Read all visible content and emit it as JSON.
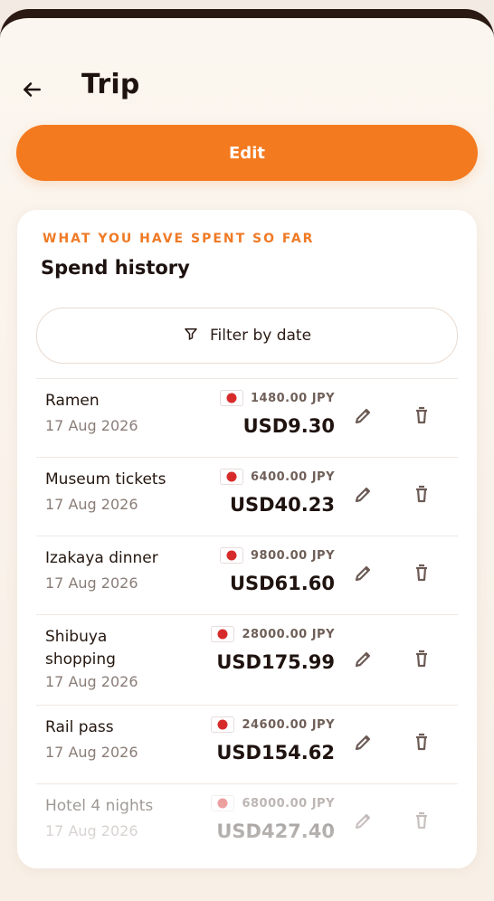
{
  "header": {
    "title": "Trip"
  },
  "actions": {
    "edit_label": "Edit"
  },
  "card": {
    "eyebrow": "WHAT YOU HAVE SPENT SO FAR",
    "title": "Spend history",
    "filter_label": "Filter by date"
  },
  "expenses": [
    {
      "name": "Ramen",
      "date": "17 Aug 2026",
      "local": "1480.00 JPY",
      "usd": "USD9.30"
    },
    {
      "name": "Museum tickets",
      "date": "17 Aug 2026",
      "local": "6400.00 JPY",
      "usd": "USD40.23"
    },
    {
      "name": "Izakaya dinner",
      "date": "17 Aug 2026",
      "local": "9800.00 JPY",
      "usd": "USD61.60"
    },
    {
      "name": "Shibuya shopping",
      "date": "17 Aug 2026",
      "local": "28000.00 JPY",
      "usd": "USD175.99"
    },
    {
      "name": "Rail pass",
      "date": "17 Aug 2026",
      "local": "24600.00 JPY",
      "usd": "USD154.62"
    },
    {
      "name": "Hotel 4 nights",
      "date": "17 Aug 2026",
      "local": "68000.00 JPY",
      "usd": "USD427.40"
    }
  ],
  "icons": {
    "back": "arrow-left-icon",
    "filter": "filter-icon",
    "edit": "pencil-icon",
    "delete": "trash-icon",
    "flag": "japan-flag-icon"
  },
  "colors": {
    "accent": "#f47a1f",
    "background": "#fbf6ef",
    "text": "#1f130f"
  }
}
